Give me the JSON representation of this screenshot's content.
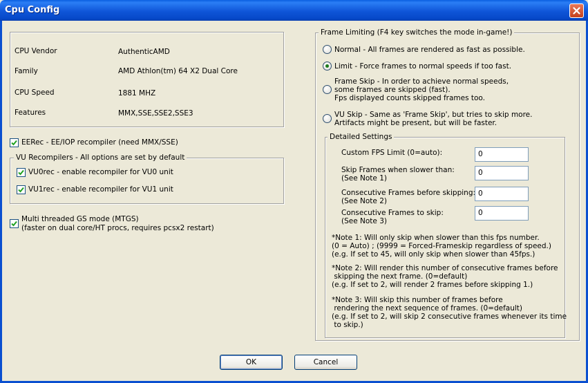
{
  "window": {
    "title": "Cpu Config"
  },
  "cpu_info": {
    "rows": [
      {
        "label": "CPU Vendor",
        "value": "AuthenticAMD"
      },
      {
        "label": "Family",
        "value": "AMD Athlon(tm) 64 X2 Dual Core"
      },
      {
        "label": "CPU Speed",
        "value": "1881 MHZ"
      },
      {
        "label": "Features",
        "value": "MMX,SSE,SSE2,SSE3"
      }
    ]
  },
  "eerec": {
    "label": "EERec -  EE/IOP recompiler (need MMX/SSE)",
    "checked": true
  },
  "vu_group": {
    "legend": "VU Recompilers - All options are set by default",
    "vu0": {
      "label": "VU0rec - enable recompiler for VU0 unit",
      "checked": true
    },
    "vu1": {
      "label": "VU1rec - enable recompiler for VU1 unit",
      "checked": true
    }
  },
  "mtgs": {
    "line1": "Multi threaded GS mode (MTGS)",
    "line2": "(faster on dual core/HT procs, requires pcsx2 restart)",
    "checked": true
  },
  "frame_limiting": {
    "legend": "Frame Limiting (F4 key switches the mode in-game!)",
    "options": [
      {
        "text": "Normal - All frames are rendered as fast as possible.",
        "selected": false
      },
      {
        "text": "Limit - Force frames to normal speeds if too fast.",
        "selected": true
      },
      {
        "text": "Frame Skip - In order to achieve normal speeds,\nsome frames are skipped (fast).\nFps displayed counts skipped frames too.",
        "selected": false
      },
      {
        "text": "VU Skip - Same as 'Frame Skip', but tries to skip more.\nArtifacts might be present, but will be faster.",
        "selected": false
      }
    ]
  },
  "detailed": {
    "legend": "Detailed Settings",
    "fields": [
      {
        "label": "Custom FPS Limit (0=auto):",
        "value": "0"
      },
      {
        "label": "Skip Frames when slower than:\n(See Note 1)",
        "value": "0"
      },
      {
        "label": "Consecutive Frames before skipping:\n(See Note 2)",
        "value": "0"
      },
      {
        "label": "Consecutive Frames to skip:\n(See Note 3)",
        "value": "0"
      }
    ],
    "notes": [
      "*Note 1: Will only skip when slower than this fps number.\n(0 = Auto) ; (9999 = Forced-Frameskip regardless of speed.)\n(e.g. If set to 45, will only skip when slower than 45fps.)",
      "*Note 2: Will render this number of consecutive frames before\n skipping the next frame. (0=default)\n(e.g. If set to 2, will render 2 frames before skipping 1.)",
      "*Note 3: Will skip this number of frames before\n rendering the next sequence of frames. (0=default)\n(e.g. If set to 2, will skip 2 consecutive frames whenever its time\n to skip.)"
    ]
  },
  "buttons": {
    "ok": "OK",
    "cancel": "Cancel"
  }
}
